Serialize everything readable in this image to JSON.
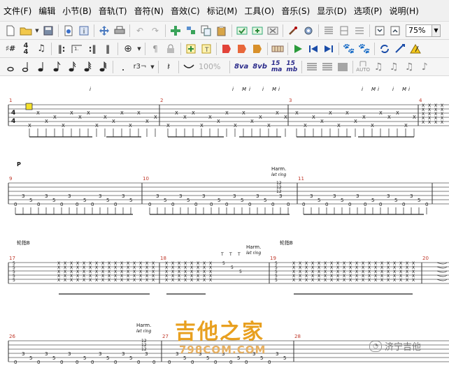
{
  "menu": [
    {
      "label": "文件(F)"
    },
    {
      "label": "编辑"
    },
    {
      "label": "小节(B)"
    },
    {
      "label": "音轨(T)"
    },
    {
      "label": "音符(N)"
    },
    {
      "label": "音效(C)"
    },
    {
      "label": "标记(M)"
    },
    {
      "label": "工具(O)"
    },
    {
      "label": "音乐(S)"
    },
    {
      "label": "显示(D)"
    },
    {
      "label": "选项(P)"
    },
    {
      "label": "说明(H)"
    }
  ],
  "toolbar": {
    "zoom_value": "75%",
    "volume_value": "100%",
    "octave_8va": "8va",
    "octave_8vb": "8vb",
    "octave_15ma": "15\nma",
    "octave_15mb": "15\nmb",
    "tuplet_label": "r3¬",
    "rest_label": "¶",
    "auto_label": "AUTO"
  },
  "score": {
    "systems": [
      {
        "measure_numbers": [
          "1",
          "2",
          "3",
          "4"
        ],
        "annotations": [
          {
            "text": "i",
            "col": "a1"
          },
          {
            "text": "i",
            "col": "a2"
          },
          {
            "text": "M",
            "col": "a3"
          },
          {
            "text": "i",
            "col": "a4"
          },
          {
            "text": "i",
            "col": "a5"
          },
          {
            "text": "M",
            "col": "a6"
          },
          {
            "text": "i",
            "col": "a7"
          },
          {
            "text": "i",
            "col": "a8"
          },
          {
            "text": "M",
            "col": "a9"
          },
          {
            "text": "i",
            "col": "a10"
          },
          {
            "text": "i",
            "col": "a11"
          },
          {
            "text": "M",
            "col": "a12"
          },
          {
            "text": "i",
            "col": "a13"
          }
        ]
      },
      {
        "measure_numbers": [
          "9",
          "10",
          "11"
        ],
        "dynamic": "P",
        "harm_label": "Harm.",
        "let_ring_label": "let ring",
        "harm_frets": [
          "12",
          "12",
          "12"
        ]
      },
      {
        "measure_numbers": [
          "17",
          "18",
          "19",
          "20"
        ],
        "section_label_1": "轮指B",
        "section_label_2": "轮指B",
        "harm_label": "Harm.",
        "let_ring_label": "let ring",
        "t_marks": [
          "T",
          "T",
          "T"
        ],
        "harm_frets": [
          "5",
          "5",
          "5"
        ]
      },
      {
        "measure_numbers": [
          "26",
          "27",
          "28"
        ],
        "harm_label": "Harm.",
        "let_ring_label": "let ring",
        "harm_frets": [
          "12",
          "12",
          "12"
        ]
      }
    ],
    "tab_numbers": {
      "fret_3": "3",
      "fret_5": "5",
      "fret_0": "0"
    }
  },
  "watermark": {
    "main": "吉他之家",
    "url": "798COM.COM",
    "brand": "济宁吉他"
  }
}
